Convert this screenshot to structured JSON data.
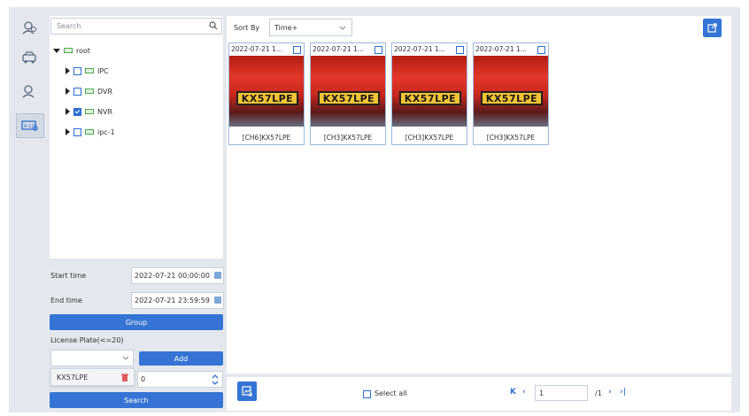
{
  "sidebar": {
    "items": [
      {
        "icon": "face-search-icon"
      },
      {
        "icon": "vehicle-search-icon"
      },
      {
        "icon": "person-search-icon"
      },
      {
        "icon": "plate-search-icon"
      }
    ]
  },
  "search": {
    "placeholder": "Search"
  },
  "tree": {
    "root": "root",
    "nodes": [
      {
        "label": "IPC",
        "checked": false
      },
      {
        "label": "DVR",
        "checked": false
      },
      {
        "label": "NVR",
        "checked": true
      },
      {
        "label": "ipc-1",
        "checked": false
      }
    ]
  },
  "form": {
    "start_label": "Start time",
    "start_value": "2022-07-21 00:00:00",
    "end_label": "End time",
    "end_value": "2022-07-21 23:59:59",
    "group_button": "Group",
    "plate_label": "License Plate(<=20)",
    "add_button": "Add",
    "plate_entry": "KX57LPE",
    "threshold_value": "0",
    "search_button": "Search"
  },
  "toolbar": {
    "sort_label": "Sort By",
    "sort_value": "Time+"
  },
  "results": [
    {
      "timestamp": "2022-07-21 1...",
      "plate": "KX57LPE",
      "caption": "[CH6]KX57LPE"
    },
    {
      "timestamp": "2022-07-21 1...",
      "plate": "KX57LPE",
      "caption": "[CH3]KX57LPE"
    },
    {
      "timestamp": "2022-07-21 1...",
      "plate": "KX57LPE",
      "caption": "[CH3]KX57LPE"
    },
    {
      "timestamp": "2022-07-21 1...",
      "plate": "KX57LPE",
      "caption": "[CH3]KX57LPE"
    }
  ],
  "footer": {
    "select_all": "Select all",
    "page_value": "1",
    "page_total": "/1"
  },
  "colors": {
    "accent": "#3574d4",
    "panel_bg": "#e4e8ee"
  }
}
